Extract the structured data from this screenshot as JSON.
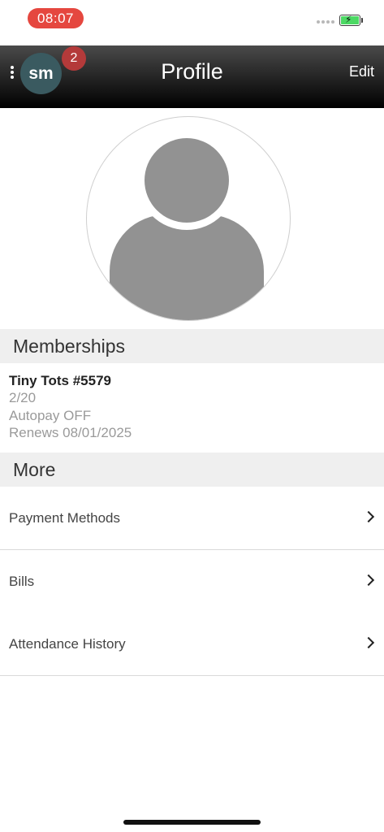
{
  "status_bar": {
    "time": "08:07",
    "battery_icon": "battery-charging-icon",
    "colors": {
      "time_pill": "#e5473f",
      "battery_fill": "#4cd964"
    }
  },
  "nav": {
    "title": "Profile",
    "edit_label": "Edit",
    "avatar_initials": "sm",
    "notification_count": "2",
    "menu_icon": "kebab-menu-icon",
    "colors": {
      "avatar": "#3a5a60",
      "badge": "#b43a3a"
    }
  },
  "profile": {
    "photo_icon": "person-placeholder-icon"
  },
  "memberships": {
    "header": "Memberships",
    "items": [
      {
        "name": "Tiny Tots #5579",
        "count": "2/20",
        "autopay": "Autopay OFF",
        "renews": "Renews 08/01/2025"
      }
    ]
  },
  "more": {
    "header": "More",
    "items": [
      {
        "label": "Payment Methods",
        "icon": "chevron-right-icon"
      },
      {
        "label": "Bills",
        "icon": "chevron-right-icon"
      },
      {
        "label": "Attendance History",
        "icon": "chevron-right-icon"
      }
    ]
  }
}
